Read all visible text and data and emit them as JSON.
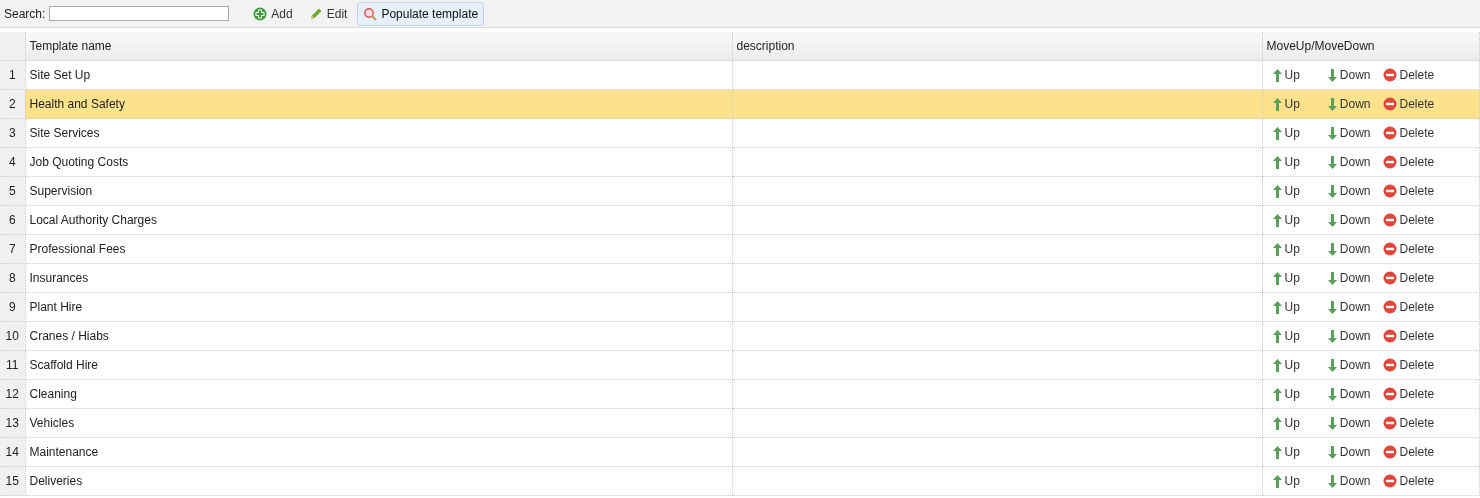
{
  "toolbar": {
    "search_label": "Search:",
    "buttons": [
      {
        "kind": "add",
        "label": "Add",
        "selected": false
      },
      {
        "kind": "edit",
        "label": "Edit",
        "selected": false
      },
      {
        "kind": "populate",
        "label": "Populate template",
        "selected": true
      }
    ]
  },
  "table": {
    "columns": [
      "Template name",
      "description",
      "MoveUp/MoveDown"
    ],
    "rows": [
      {
        "number": "1",
        "name": "Site Set Up",
        "up": "Up",
        "down": "Down",
        "delete": "Delete",
        "selected": false
      },
      {
        "number": "2",
        "name": "Health and Safety",
        "up": "Up",
        "down": "Down",
        "delete": "Delete",
        "selected": true
      },
      {
        "number": "3",
        "name": "Site Services",
        "up": "Up",
        "down": "Down",
        "delete": "Delete",
        "selected": false
      },
      {
        "number": "4",
        "name": "Job Quoting Costs",
        "up": "Up",
        "down": "Down",
        "delete": "Delete",
        "selected": false
      },
      {
        "number": "5",
        "name": "Supervision",
        "up": "Up",
        "down": "Down",
        "delete": "Delete",
        "selected": false
      },
      {
        "number": "6",
        "name": "Local Authority Charges",
        "up": "Up",
        "down": "Down",
        "delete": "Delete",
        "selected": false
      },
      {
        "number": "7",
        "name": "Professional Fees",
        "up": "Up",
        "down": "Down",
        "delete": "Delete",
        "selected": false
      },
      {
        "number": "8",
        "name": "Insurances",
        "up": "Up",
        "down": "Down",
        "delete": "Delete",
        "selected": false
      },
      {
        "number": "9",
        "name": "Plant Hire",
        "up": "Up",
        "down": "Down",
        "delete": "Delete",
        "selected": false
      },
      {
        "number": "10",
        "name": "Cranes / Hiabs",
        "up": "Up",
        "down": "Down",
        "delete": "Delete",
        "selected": false
      },
      {
        "number": "11",
        "name": "Scaffold Hire",
        "up": "Up",
        "down": "Down",
        "delete": "Delete",
        "selected": false
      },
      {
        "number": "12",
        "name": "Cleaning",
        "up": "Up",
        "down": "Down",
        "delete": "Delete",
        "selected": false
      },
      {
        "number": "13",
        "name": "Vehicles",
        "up": "Up",
        "down": "Down",
        "delete": "Delete",
        "selected": false
      },
      {
        "number": "14",
        "name": "Maintenance",
        "up": "Up",
        "down": "Down",
        "delete": "Delete",
        "selected": false
      },
      {
        "number": "15",
        "name": "Deliveries",
        "up": "Up",
        "down": "Down",
        "delete": "Delete",
        "selected": false
      }
    ]
  }
}
